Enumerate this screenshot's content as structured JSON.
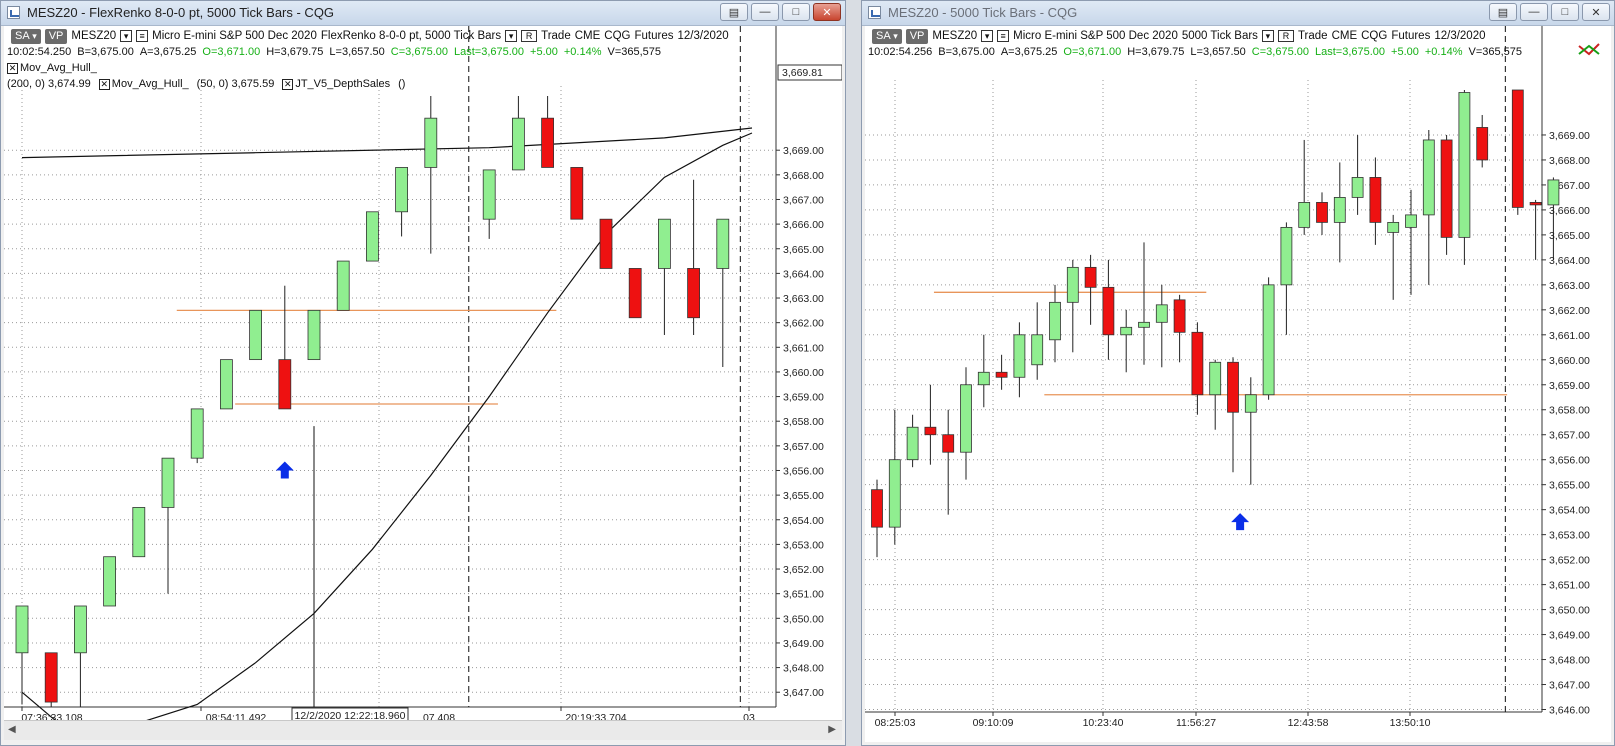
{
  "left": {
    "title": "MESZ20 - FlexRenko 8-0-0 pt, 5000 Tick Bars - CQG",
    "toolbar": {
      "sa": "SA",
      "vp": "VP",
      "symbol": "MESZ20",
      "market": "Micro E-mini S&P 500 Dec 2020",
      "bars": "FlexRenko 8-0-0 pt, 5000 Tick Bars",
      "r": "R",
      "trade": "Trade",
      "exchange": "CME",
      "feed": "CQG",
      "type": "Futures",
      "date": "12/3/2020"
    },
    "status": {
      "time": "10:02:54.250",
      "b": "B=3,675.00",
      "a": "A=3,675.25",
      "o": "O=3,671.00",
      "h": "H=3,679.75",
      "l": "L=3,657.50",
      "c": "C=3,675.00",
      "last": "Last=3,675.00",
      "chg": "+5.00",
      "pct": "+0.14%",
      "v": "V=365,575"
    },
    "indicators": {
      "hull1": "Mov_Avg_Hull_",
      "hull1_params": "(200,  0)  3,674.99",
      "hull2": "Mov_Avg_Hull_",
      "hull2_params": "(50,  0)  3,675.59",
      "depth": "JT_V5_DepthSales",
      "depth_params": "()"
    },
    "price_label": "3,669.81",
    "x_labels": [
      "07:36:33.108",
      "08:54:11.492",
      "07.408",
      "20:19:33.704",
      "03"
    ],
    "cursor_time": "12/2/2020 12:22:18.960"
  },
  "right": {
    "title": "MESZ20 - 5000 Tick Bars - CQG",
    "toolbar": {
      "sa": "SA",
      "vp": "VP",
      "symbol": "MESZ20",
      "market": "Micro E-mini S&P 500 Dec 2020",
      "bars": "5000 Tick Bars",
      "r": "R",
      "trade": "Trade",
      "exchange": "CME",
      "feed": "CQG",
      "type": "Futures",
      "date": "12/3/2020"
    },
    "status": {
      "time": "10:02:54.256",
      "b": "B=3,675.00",
      "a": "A=3,675.25",
      "o": "O=3,671.00",
      "h": "H=3,679.75",
      "l": "L=3,657.50",
      "c": "C=3,675.00",
      "last": "Last=3,675.00",
      "chg": "+5.00",
      "pct": "+0.14%",
      "v": "V=365,575"
    },
    "x_labels": [
      "08:25:03",
      "09:10:09",
      "10:23:40",
      "11:56:27",
      "12:43:58",
      "13:50:10"
    ]
  },
  "colors": {
    "up": "#90ee90",
    "down": "#ee1111",
    "ma": "#111111",
    "level": "#e8955a",
    "arrow": "#0a2ee8",
    "grid": "#9a9a9a"
  },
  "chart_data": [
    {
      "type": "candlestick",
      "name_ref": "left",
      "ylim": [
        3646.4,
        3671.2
      ],
      "y_ticks": [
        3647,
        3648,
        3649,
        3650,
        3651,
        3652,
        3653,
        3654,
        3655,
        3656,
        3657,
        3658,
        3659,
        3660,
        3661,
        3662,
        3663,
        3664,
        3665,
        3666,
        3667,
        3668,
        3669
      ],
      "candles": [
        {
          "i": 0,
          "o": 3648.6,
          "c": 3650.5,
          "h": 3650.5,
          "l": 3646.5,
          "dir": "up"
        },
        {
          "i": 1,
          "o": 3648.6,
          "c": 3646.6,
          "h": 3648.6,
          "l": 3646.4,
          "dir": "down"
        },
        {
          "i": 2,
          "o": 3648.6,
          "c": 3650.5,
          "h": 3650.5,
          "l": 3646.4,
          "dir": "up"
        },
        {
          "i": 3,
          "o": 3650.5,
          "c": 3652.5,
          "h": 3652.5,
          "l": 3650.5,
          "dir": "up"
        },
        {
          "i": 4,
          "o": 3652.5,
          "c": 3654.5,
          "h": 3654.5,
          "l": 3652.5,
          "dir": "up"
        },
        {
          "i": 5,
          "o": 3654.5,
          "c": 3656.5,
          "h": 3656.5,
          "l": 3651.0,
          "dir": "up"
        },
        {
          "i": 6,
          "o": 3656.5,
          "c": 3658.5,
          "h": 3658.5,
          "l": 3656.3,
          "dir": "up"
        },
        {
          "i": 7,
          "o": 3658.5,
          "c": 3660.5,
          "h": 3660.5,
          "l": 3658.5,
          "dir": "up"
        },
        {
          "i": 8,
          "o": 3660.5,
          "c": 3662.5,
          "h": 3662.5,
          "l": 3660.5,
          "dir": "up"
        },
        {
          "i": 9,
          "o": 3660.5,
          "c": 3658.5,
          "h": 3663.5,
          "l": 3658.5,
          "dir": "down"
        },
        {
          "i": 10,
          "o": 3660.5,
          "c": 3662.5,
          "h": 3662.5,
          "l": 3660.5,
          "dir": "up"
        },
        {
          "i": 11,
          "o": 3662.5,
          "c": 3664.5,
          "h": 3664.5,
          "l": 3662.5,
          "dir": "up"
        },
        {
          "i": 12,
          "o": 3664.5,
          "c": 3666.5,
          "h": 3666.5,
          "l": 3664.5,
          "dir": "up"
        },
        {
          "i": 13,
          "o": 3666.5,
          "c": 3668.3,
          "h": 3668.3,
          "l": 3665.5,
          "dir": "up"
        },
        {
          "i": 14,
          "o": 3668.3,
          "c": 3670.3,
          "h": 3671.2,
          "l": 3664.8,
          "dir": "up"
        },
        {
          "i": 16,
          "o": 3666.2,
          "c": 3668.2,
          "h": 3668.2,
          "l": 3665.4,
          "dir": "up"
        },
        {
          "i": 17,
          "o": 3668.2,
          "c": 3670.3,
          "h": 3671.2,
          "l": 3668.2,
          "dir": "up"
        },
        {
          "i": 18,
          "o": 3670.3,
          "c": 3668.3,
          "h": 3671.2,
          "l": 3668.3,
          "dir": "down"
        },
        {
          "i": 19,
          "o": 3668.3,
          "c": 3666.2,
          "h": 3668.3,
          "l": 3666.2,
          "dir": "down"
        },
        {
          "i": 20,
          "o": 3666.2,
          "c": 3664.2,
          "h": 3666.2,
          "l": 3664.2,
          "dir": "down"
        },
        {
          "i": 21,
          "o": 3664.2,
          "c": 3662.2,
          "h": 3664.2,
          "l": 3662.2,
          "dir": "down"
        },
        {
          "i": 22,
          "o": 3664.2,
          "c": 3666.2,
          "h": 3666.2,
          "l": 3661.5,
          "dir": "up"
        },
        {
          "i": 23,
          "o": 3664.2,
          "c": 3662.2,
          "h": 3667.8,
          "l": 3661.5,
          "dir": "down"
        },
        {
          "i": 24,
          "o": 3664.2,
          "c": 3666.2,
          "h": 3666.2,
          "l": 3660.2,
          "dir": "up"
        }
      ],
      "levels": [
        {
          "y": 3662.5,
          "from": 5.3,
          "to": 18.3
        },
        {
          "y": 3658.7,
          "from": 7.3,
          "to": 16.3
        }
      ],
      "markers": [
        {
          "i": 9,
          "y": 3656.0
        }
      ],
      "vlines": [
        {
          "i": 10,
          "style": "solid",
          "from": 3646.4,
          "to": 3657.8
        },
        {
          "i": 15.3,
          "style": "dash"
        },
        {
          "i": 24.6,
          "style": "dash"
        }
      ],
      "ma_upper": [
        [
          0,
          3668.7
        ],
        [
          8,
          3668.9
        ],
        [
          16,
          3669.1
        ],
        [
          22,
          3669.5
        ],
        [
          25,
          3669.9
        ]
      ],
      "ma_curve": [
        [
          0,
          3647.0
        ],
        [
          1,
          3646.0
        ],
        [
          2,
          3645.0
        ],
        [
          6,
          3646.5
        ],
        [
          8,
          3648.2
        ],
        [
          10,
          3650.2
        ],
        [
          12,
          3652.8
        ],
        [
          14,
          3655.8
        ],
        [
          16,
          3659.0
        ],
        [
          18,
          3662.4
        ],
        [
          20,
          3665.6
        ],
        [
          22,
          3667.9
        ],
        [
          24,
          3669.2
        ],
        [
          25,
          3669.7
        ]
      ]
    },
    {
      "type": "candlestick",
      "name_ref": "right",
      "ylim": [
        3645.9,
        3670.8
      ],
      "y_ticks": [
        3646,
        3647,
        3648,
        3649,
        3650,
        3651,
        3652,
        3653,
        3654,
        3655,
        3656,
        3657,
        3658,
        3659,
        3660,
        3661,
        3662,
        3663,
        3664,
        3665,
        3666,
        3667,
        3668,
        3669
      ],
      "candles": [
        {
          "i": 0,
          "o": 3654.8,
          "c": 3653.3,
          "h": 3655.2,
          "l": 3652.1,
          "dir": "down"
        },
        {
          "i": 1,
          "o": 3653.3,
          "c": 3656.0,
          "h": 3658.0,
          "l": 3652.6,
          "dir": "up"
        },
        {
          "i": 2,
          "o": 3656.0,
          "c": 3657.3,
          "h": 3657.8,
          "l": 3655.7,
          "dir": "up"
        },
        {
          "i": 3,
          "o": 3657.3,
          "c": 3657.0,
          "h": 3659.0,
          "l": 3655.8,
          "dir": "down"
        },
        {
          "i": 4,
          "o": 3657.0,
          "c": 3656.3,
          "h": 3658.0,
          "l": 3653.8,
          "dir": "down"
        },
        {
          "i": 5,
          "o": 3656.3,
          "c": 3659.0,
          "h": 3659.7,
          "l": 3655.2,
          "dir": "up"
        },
        {
          "i": 6,
          "o": 3659.0,
          "c": 3659.5,
          "h": 3661.0,
          "l": 3658.1,
          "dir": "up"
        },
        {
          "i": 7,
          "o": 3659.5,
          "c": 3659.3,
          "h": 3660.2,
          "l": 3658.8,
          "dir": "down"
        },
        {
          "i": 8,
          "o": 3659.3,
          "c": 3661.0,
          "h": 3661.5,
          "l": 3658.5,
          "dir": "up"
        },
        {
          "i": 9,
          "o": 3659.8,
          "c": 3661.0,
          "h": 3662.3,
          "l": 3659.2,
          "dir": "up"
        },
        {
          "i": 10,
          "o": 3660.8,
          "c": 3662.3,
          "h": 3663.0,
          "l": 3659.9,
          "dir": "up"
        },
        {
          "i": 11,
          "o": 3662.3,
          "c": 3663.7,
          "h": 3664.0,
          "l": 3660.3,
          "dir": "up"
        },
        {
          "i": 12,
          "o": 3663.7,
          "c": 3662.9,
          "h": 3664.2,
          "l": 3661.4,
          "dir": "down"
        },
        {
          "i": 13,
          "o": 3662.9,
          "c": 3661.0,
          "h": 3664.0,
          "l": 3660.0,
          "dir": "down"
        },
        {
          "i": 14,
          "o": 3661.0,
          "c": 3661.3,
          "h": 3662.0,
          "l": 3659.5,
          "dir": "up"
        },
        {
          "i": 15,
          "o": 3661.3,
          "c": 3661.5,
          "h": 3664.7,
          "l": 3659.8,
          "dir": "up"
        },
        {
          "i": 16,
          "o": 3661.5,
          "c": 3662.2,
          "h": 3663.0,
          "l": 3659.7,
          "dir": "up"
        },
        {
          "i": 17,
          "o": 3662.4,
          "c": 3661.1,
          "h": 3662.6,
          "l": 3659.9,
          "dir": "down"
        },
        {
          "i": 18,
          "o": 3661.1,
          "c": 3658.6,
          "h": 3661.5,
          "l": 3657.8,
          "dir": "down"
        },
        {
          "i": 19,
          "o": 3658.6,
          "c": 3659.9,
          "h": 3660.0,
          "l": 3657.2,
          "dir": "up"
        },
        {
          "i": 20,
          "o": 3659.9,
          "c": 3657.9,
          "h": 3660.1,
          "l": 3655.5,
          "dir": "down"
        },
        {
          "i": 21,
          "o": 3657.9,
          "c": 3658.6,
          "h": 3659.3,
          "l": 3655.0,
          "dir": "up"
        },
        {
          "i": 22,
          "o": 3658.6,
          "c": 3663.0,
          "h": 3663.3,
          "l": 3658.4,
          "dir": "up"
        },
        {
          "i": 23,
          "o": 3663.0,
          "c": 3665.3,
          "h": 3665.5,
          "l": 3661.0,
          "dir": "up"
        },
        {
          "i": 24,
          "o": 3665.3,
          "c": 3666.3,
          "h": 3668.8,
          "l": 3665.0,
          "dir": "up"
        },
        {
          "i": 25,
          "o": 3666.3,
          "c": 3665.5,
          "h": 3666.7,
          "l": 3665.0,
          "dir": "down"
        },
        {
          "i": 26,
          "o": 3665.5,
          "c": 3666.5,
          "h": 3667.9,
          "l": 3663.9,
          "dir": "up"
        },
        {
          "i": 27,
          "o": 3666.5,
          "c": 3667.3,
          "h": 3669.0,
          "l": 3665.8,
          "dir": "up"
        },
        {
          "i": 28,
          "o": 3667.3,
          "c": 3665.5,
          "h": 3668.1,
          "l": 3664.6,
          "dir": "down"
        },
        {
          "i": 29,
          "o": 3665.1,
          "c": 3665.5,
          "h": 3665.8,
          "l": 3662.4,
          "dir": "up"
        },
        {
          "i": 30,
          "o": 3665.3,
          "c": 3665.8,
          "h": 3666.8,
          "l": 3662.6,
          "dir": "up"
        },
        {
          "i": 31,
          "o": 3665.8,
          "c": 3668.8,
          "h": 3669.2,
          "l": 3663.0,
          "dir": "up"
        },
        {
          "i": 32,
          "o": 3668.8,
          "c": 3664.9,
          "h": 3669.0,
          "l": 3664.2,
          "dir": "down"
        },
        {
          "i": 33,
          "o": 3664.9,
          "c": 3670.7,
          "h": 3670.8,
          "l": 3663.8,
          "dir": "up"
        },
        {
          "i": 34,
          "o": 3669.3,
          "c": 3668.0,
          "h": 3669.8,
          "l": 3667.7,
          "dir": "down"
        },
        {
          "i": 36,
          "o": 3670.8,
          "c": 3666.1,
          "h": 3670.8,
          "l": 3665.8,
          "dir": "down"
        },
        {
          "i": 37,
          "o": 3666.2,
          "c": 3666.3,
          "h": 3666.4,
          "l": 3664.0,
          "dir": "down"
        },
        {
          "i": 38,
          "o": 3666.2,
          "c": 3667.2,
          "h": 3667.3,
          "l": 3664.0,
          "dir": "up"
        }
      ],
      "levels": [
        {
          "y": 3662.7,
          "from": 3.2,
          "to": 18.5
        },
        {
          "y": 3658.6,
          "from": 9.4,
          "to": 35.4
        }
      ],
      "markers": [
        {
          "i": 20.4,
          "y": 3653.5
        }
      ],
      "vlines": [
        {
          "i": 35.3,
          "style": "dash"
        }
      ]
    }
  ]
}
